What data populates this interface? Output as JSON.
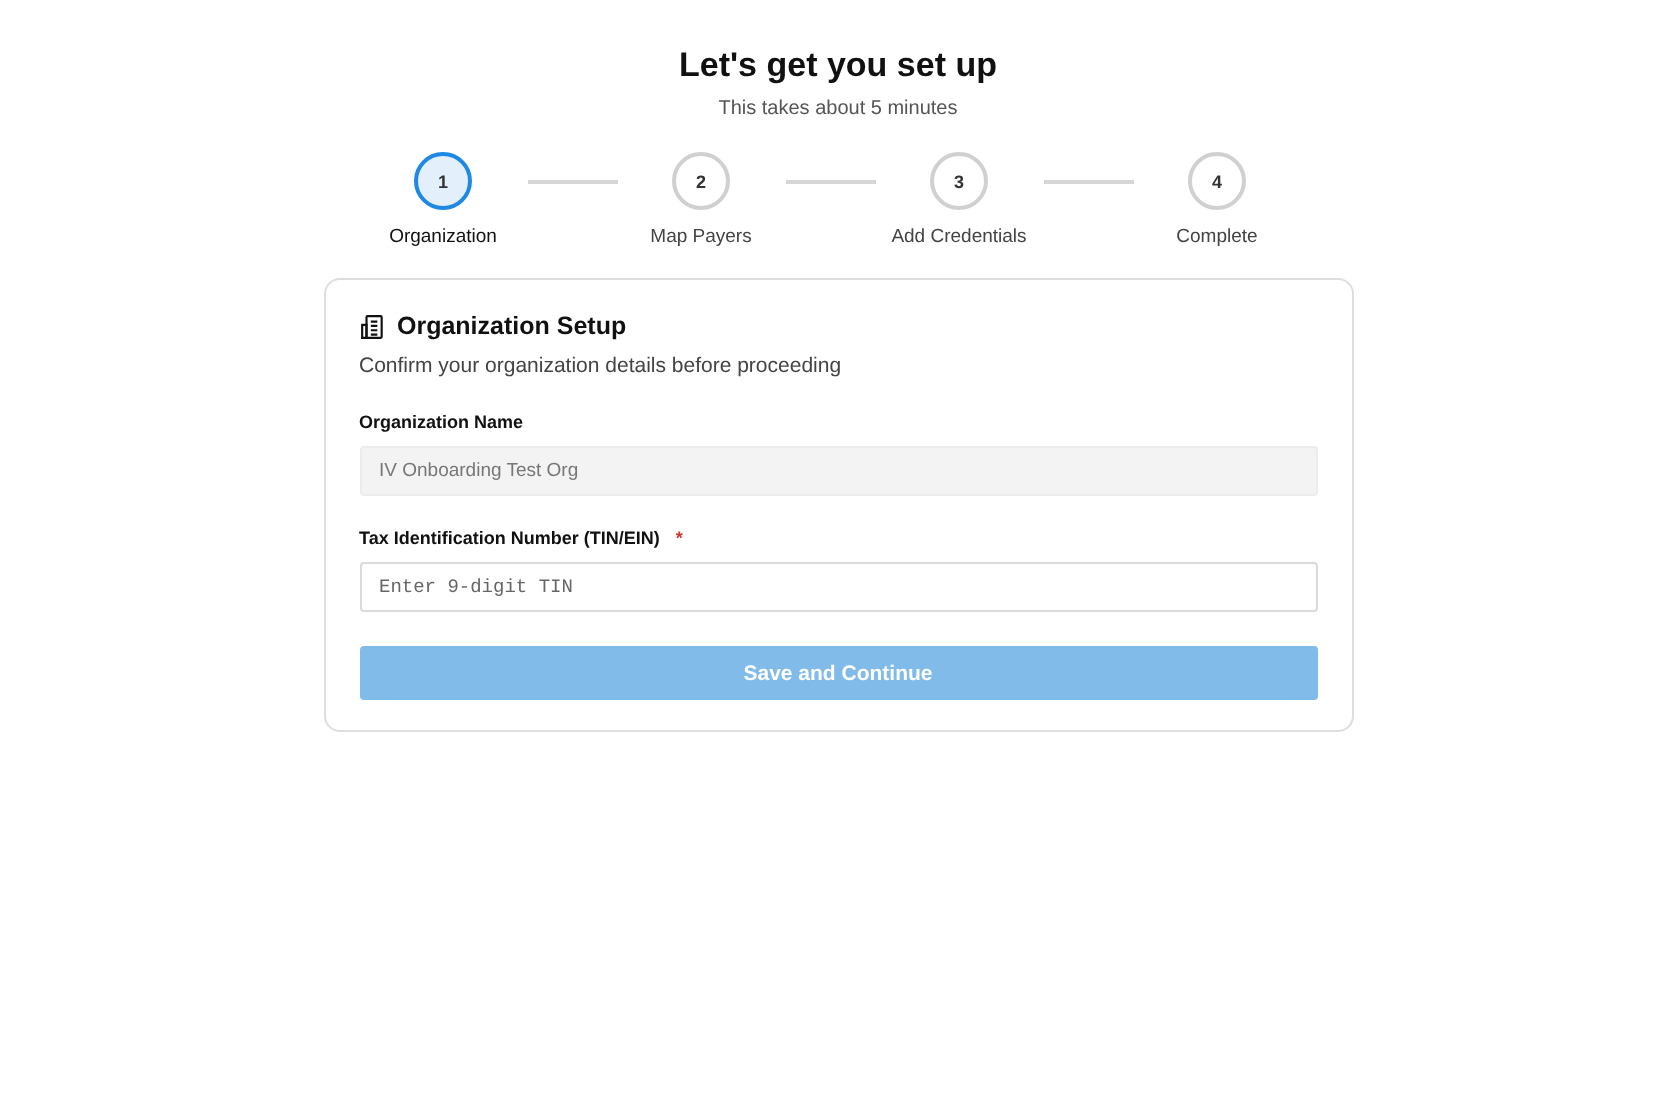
{
  "header": {
    "title": "Let's get you set up",
    "subtitle": "This takes about 5 minutes"
  },
  "steps": [
    {
      "number": "1",
      "label": "Organization",
      "selected": true
    },
    {
      "number": "2",
      "label": "Map Payers",
      "selected": false
    },
    {
      "number": "3",
      "label": "Add Credentials",
      "selected": false
    },
    {
      "number": "4",
      "label": "Complete",
      "selected": false
    }
  ],
  "card": {
    "title": "Organization Setup",
    "description": "Confirm your organization details before proceeding",
    "fields": [
      {
        "label": "Organization Name",
        "value": "IV Onboarding Test Org",
        "disabled": true
      },
      {
        "label": "Tax Identification Number (TIN/EIN)",
        "required_mark": "*",
        "placeholder": "Enter 9-digit TIN",
        "disabled": false
      }
    ],
    "button": {
      "label": "Save and Continue",
      "disabled": true
    }
  }
}
